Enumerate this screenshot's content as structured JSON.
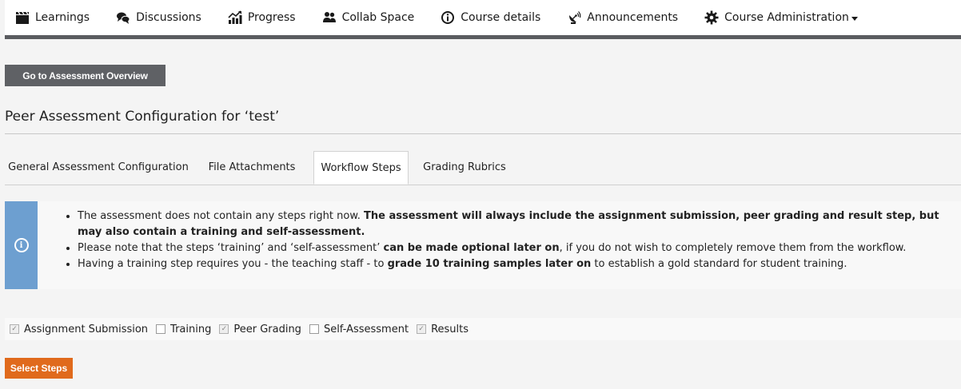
{
  "nav": {
    "items": [
      {
        "label": "Learnings",
        "icon": "clapperboard-icon"
      },
      {
        "label": "Discussions",
        "icon": "chat-bubbles-icon"
      },
      {
        "label": "Progress",
        "icon": "progress-chart-icon"
      },
      {
        "label": "Collab Space",
        "icon": "users-icon"
      },
      {
        "label": "Course details",
        "icon": "info-icon"
      },
      {
        "label": "Announcements",
        "icon": "satellite-dish-icon"
      },
      {
        "label": "Course Administration",
        "icon": "gear-icon"
      }
    ]
  },
  "overview_button": "Go to Assessment Overview",
  "page_title": "Peer Assessment Configuration for ‘test’",
  "tabs": [
    {
      "label": "General Assessment Configuration",
      "active": false
    },
    {
      "label": "File Attachments",
      "active": false
    },
    {
      "label": "Workflow Steps",
      "active": true
    },
    {
      "label": "Grading Rubrics",
      "active": false
    }
  ],
  "info": {
    "accent_color": "#6d9fd0",
    "items": [
      {
        "parts": [
          {
            "text": "The assessment does not contain any steps right now. ",
            "bold": false
          },
          {
            "text": "The assessment will always include the assignment submission, peer grading and result step, but may also contain a training and self-assessment.",
            "bold": true
          }
        ]
      },
      {
        "parts": [
          {
            "text": "Please note that the steps ‘training’ and ‘self-assessment’ ",
            "bold": false
          },
          {
            "text": "can be made optional later on",
            "bold": true
          },
          {
            "text": ", if you do not wish to completely remove them from the workflow.",
            "bold": false
          }
        ]
      },
      {
        "parts": [
          {
            "text": "Having a training step requires you - the teaching staff - to ",
            "bold": false
          },
          {
            "text": "grade 10 training samples later on",
            "bold": true
          },
          {
            "text": " to establish a gold standard for student training.",
            "bold": false
          }
        ]
      }
    ]
  },
  "steps": [
    {
      "label": "Assignment Submission",
      "checked": true
    },
    {
      "label": "Training",
      "checked": false
    },
    {
      "label": "Peer Grading",
      "checked": true
    },
    {
      "label": "Self-Assessment",
      "checked": false
    },
    {
      "label": "Results",
      "checked": true
    }
  ],
  "select_button": "Select Steps",
  "colors": {
    "primary_button": "#e06a1c",
    "secondary_button": "#5f6165",
    "nav_border": "#5a5c60"
  }
}
